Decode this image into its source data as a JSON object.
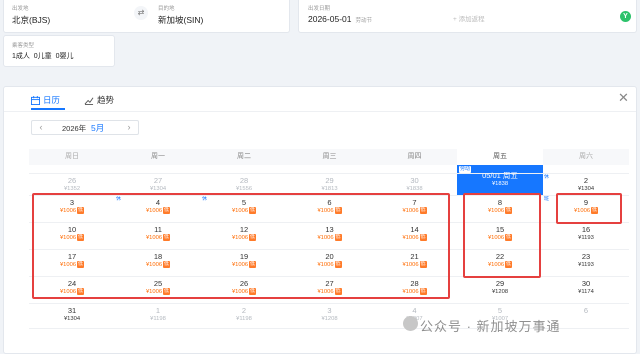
{
  "search": {
    "origin_label": "出发地",
    "origin_value": "北京(BJS)",
    "dest_label": "目的地",
    "dest_value": "新加坡(SIN)",
    "date_label": "出发日期",
    "date_value": "2026-05-01",
    "date_holiday": "劳动节",
    "add_return": "+ 添加返程",
    "pax_label": "乘客类型",
    "pax_value": "1成人  0儿童  0婴儿"
  },
  "tabs": {
    "calendar": "日历",
    "trend": "趋势"
  },
  "calendar": {
    "year": "2026年",
    "month": "5月",
    "weekdays": [
      "周日",
      "周一",
      "周二",
      "周三",
      "周四",
      "周五",
      "周六"
    ],
    "rows": [
      [
        {
          "day": "26",
          "price": "¥1352",
          "other": true
        },
        {
          "day": "27",
          "price": "¥1304",
          "other": true
        },
        {
          "day": "28",
          "price": "¥1556",
          "other": true
        },
        {
          "day": "29",
          "price": "¥1813",
          "other": true
        },
        {
          "day": "30",
          "price": "¥1838",
          "other": true
        },
        {
          "day": "05/01 周五",
          "price": "¥1838",
          "selected": true,
          "holiday": "劳动"
        },
        {
          "day": "2",
          "price": "¥1304",
          "ban": "休"
        }
      ],
      [
        {
          "day": "3",
          "price": "¥1006",
          "low": true
        },
        {
          "day": "4",
          "price": "¥1006",
          "low": true,
          "ban": "休"
        },
        {
          "day": "5",
          "price": "¥1006",
          "low": true,
          "ban": "休"
        },
        {
          "day": "6",
          "price": "¥1006",
          "low": true
        },
        {
          "day": "7",
          "price": "¥1006",
          "low": true
        },
        {
          "day": "8",
          "price": "¥1006",
          "low": true
        },
        {
          "day": "9",
          "price": "¥1006",
          "low": true,
          "ban": "班"
        }
      ],
      [
        {
          "day": "10",
          "price": "¥1006",
          "low": true
        },
        {
          "day": "11",
          "price": "¥1006",
          "low": true
        },
        {
          "day": "12",
          "price": "¥1006",
          "low": true
        },
        {
          "day": "13",
          "price": "¥1006",
          "low": true
        },
        {
          "day": "14",
          "price": "¥1006",
          "low": true
        },
        {
          "day": "15",
          "price": "¥1006",
          "low": true
        },
        {
          "day": "16",
          "price": "¥1193"
        }
      ],
      [
        {
          "day": "17",
          "price": "¥1006",
          "low": true
        },
        {
          "day": "18",
          "price": "¥1006",
          "low": true
        },
        {
          "day": "19",
          "price": "¥1006",
          "low": true
        },
        {
          "day": "20",
          "price": "¥1006",
          "low": true
        },
        {
          "day": "21",
          "price": "¥1006",
          "low": true
        },
        {
          "day": "22",
          "price": "¥1006",
          "low": true
        },
        {
          "day": "23",
          "price": "¥1193"
        }
      ],
      [
        {
          "day": "24",
          "price": "¥1006",
          "low": true
        },
        {
          "day": "25",
          "price": "¥1006",
          "low": true
        },
        {
          "day": "26",
          "price": "¥1006",
          "low": true
        },
        {
          "day": "27",
          "price": "¥1006",
          "low": true
        },
        {
          "day": "28",
          "price": "¥1006",
          "low": true
        },
        {
          "day": "29",
          "price": "¥1208"
        },
        {
          "day": "30",
          "price": "¥1174"
        }
      ],
      [
        {
          "day": "31",
          "price": "¥1304"
        },
        {
          "day": "1",
          "price": "¥1198",
          "other": true
        },
        {
          "day": "2",
          "price": "¥1198",
          "other": true
        },
        {
          "day": "3",
          "price": "¥1208",
          "other": true
        },
        {
          "day": "4",
          "price": "¥1007",
          "other": true
        },
        {
          "day": "5",
          "price": "¥1007",
          "other": true
        },
        {
          "day": "6",
          "price": "",
          "other": true
        }
      ]
    ],
    "low_badge": "低"
  },
  "watermark": "公众号 · 新加坡万事通",
  "colors": {
    "accent": "#1677ff",
    "low_price": "#ff6a00",
    "annotation": "#e5403f"
  }
}
